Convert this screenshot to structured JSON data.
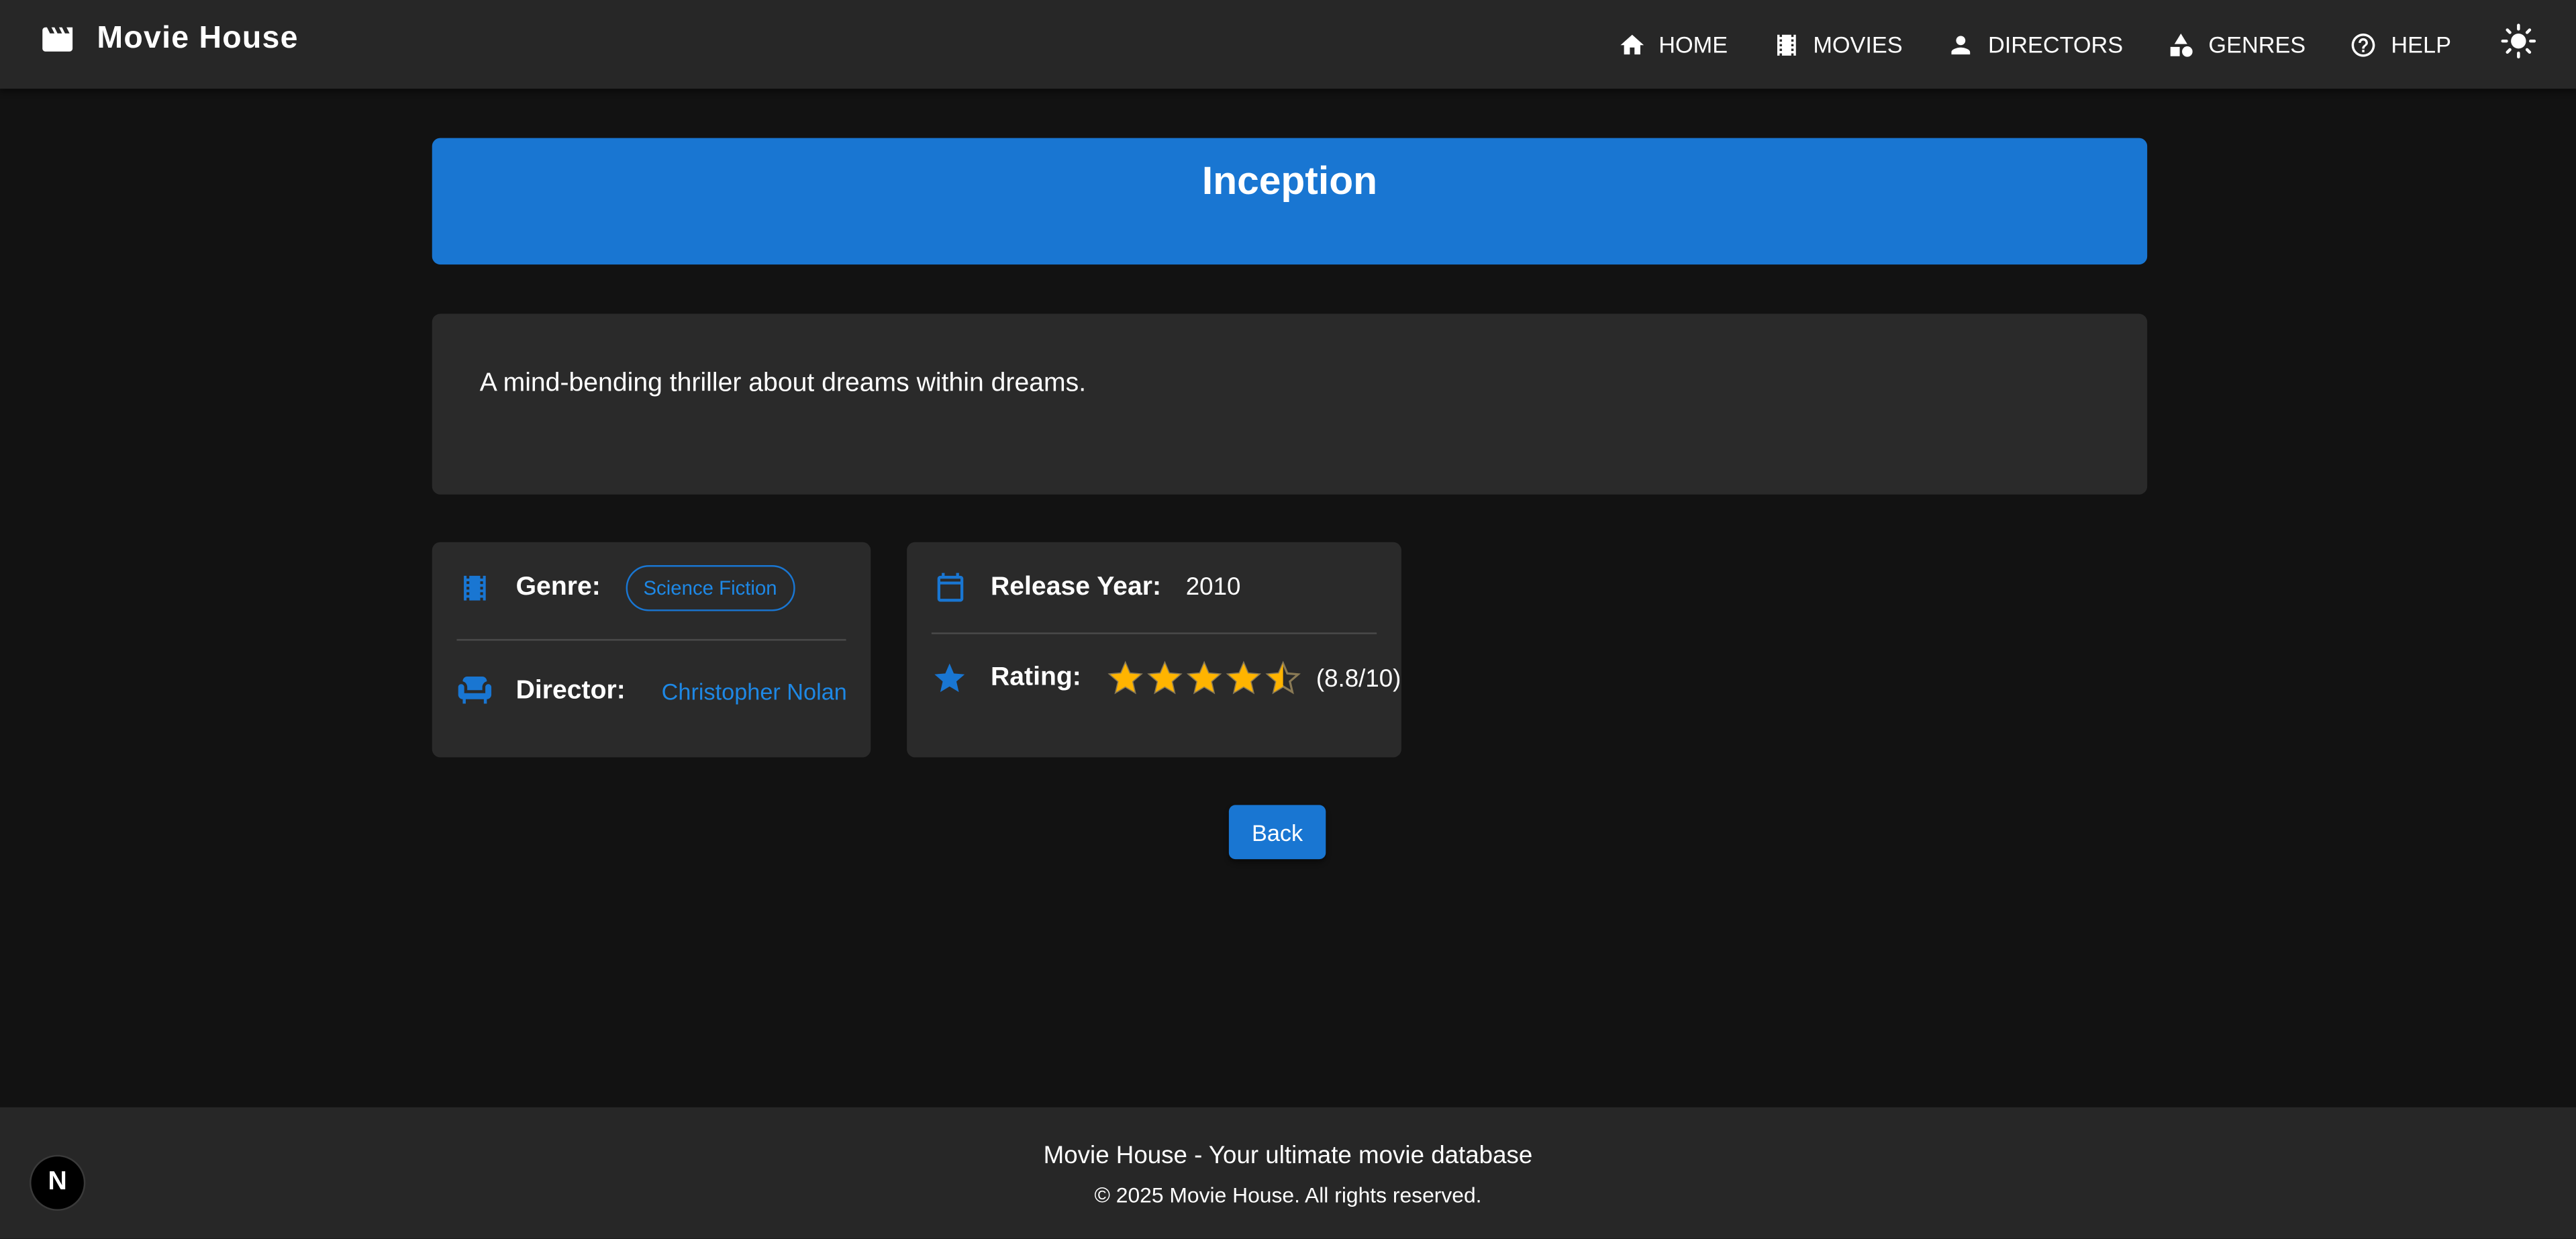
{
  "header": {
    "brand": "Movie House",
    "nav": [
      {
        "label": "HOME",
        "icon": "home-icon"
      },
      {
        "label": "MOVIES",
        "icon": "film-icon"
      },
      {
        "label": "DIRECTORS",
        "icon": "person-icon"
      },
      {
        "label": "GENRES",
        "icon": "shapes-icon"
      },
      {
        "label": "HELP",
        "icon": "help-icon"
      }
    ],
    "theme_toggle_icon": "sun-icon"
  },
  "movie": {
    "title": "Inception",
    "description": "A mind-bending thriller about dreams within dreams.",
    "genre_label": "Genre:",
    "genre": "Science Fiction",
    "director_label": "Director:",
    "director": "Christopher Nolan",
    "year_label": "Release Year:",
    "year": "2010",
    "rating_label": "Rating:",
    "rating_stars": 4.5,
    "rating_max_stars": 5,
    "rating_text": "(8.8/10)"
  },
  "actions": {
    "back_label": "Back"
  },
  "footer": {
    "title": "Movie House - Your ultimate movie database",
    "copyright": "© 2025 Movie House. All rights reserved."
  },
  "dev_badge": "N",
  "colors": {
    "accent": "#1976d2",
    "link": "#1e88e5",
    "star": "#ffb400",
    "background": "#121212",
    "surface": "#2a2a2a",
    "appbar": "#272727"
  }
}
